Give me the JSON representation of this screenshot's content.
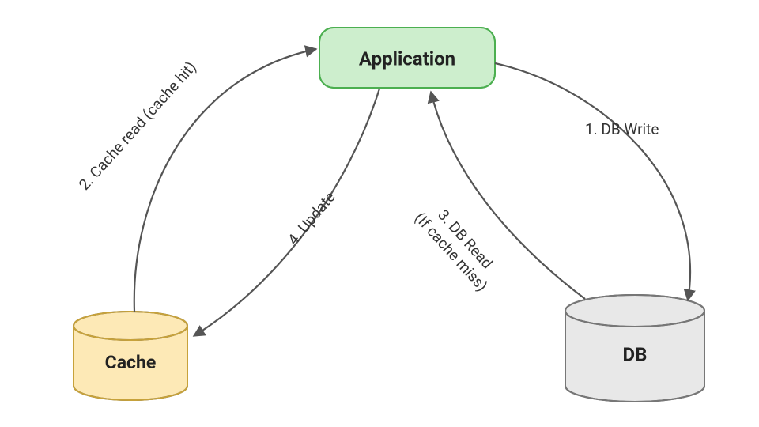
{
  "nodes": {
    "application": {
      "label": "Application",
      "fill": "#cdeecd",
      "stroke": "#4caf50"
    },
    "cache": {
      "label": "Cache",
      "fill": "#fde9b6",
      "stroke": "#c7a23b"
    },
    "db": {
      "label": "DB",
      "fill": "#e8e8e8",
      "stroke": "#777"
    }
  },
  "edges": {
    "db_write": {
      "label": "1. DB Write"
    },
    "cache_read": {
      "label": "2. Cache read (cache hit)"
    },
    "db_read": {
      "label_line1": "3. DB Read",
      "label_line2": "(If cache miss)"
    },
    "update": {
      "label": "4. Update"
    }
  }
}
